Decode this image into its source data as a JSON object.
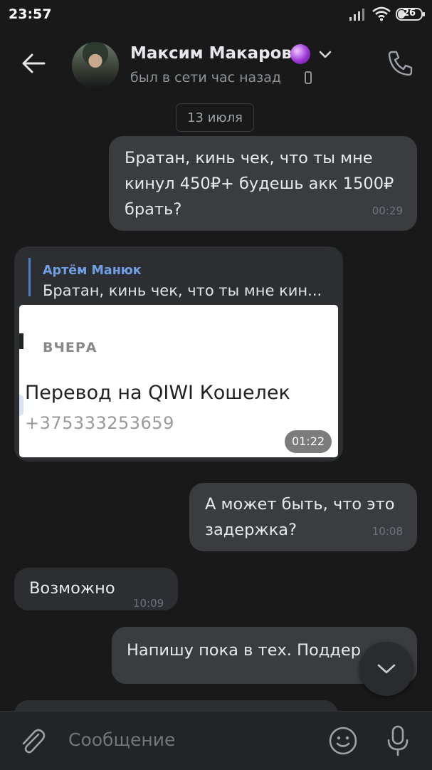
{
  "status_bar": {
    "time": "23:57",
    "battery": "26"
  },
  "header": {
    "name": "Максим Макаров",
    "status": "был в сети час назад"
  },
  "date_separator": "13 июля",
  "messages": [
    {
      "dir": "out",
      "text": "Братан, кинь чек, что ты мне кинул 450₽+ будешь акк 1500₽ брать?",
      "time": "00:29"
    },
    {
      "dir": "in",
      "reply": {
        "author": "Артём Манюк",
        "text": "Братан, кинь чек, что ты мне кин..."
      },
      "image": {
        "day_label": "ВЧЕРА",
        "title": "Перевод на QIWI Кошелек",
        "number": "+375333253659"
      },
      "time": "01:22"
    },
    {
      "dir": "out",
      "text": "А может быть, что это задержка?",
      "time": "10:08"
    },
    {
      "dir": "in",
      "text": "Возможно",
      "time": "10:09"
    },
    {
      "dir": "out",
      "text": "Напишу пока в тех. Поддер"
    }
  ],
  "composer": {
    "placeholder": "Сообщение"
  },
  "icons": {
    "back": "arrow-left-icon",
    "call": "phone-icon",
    "attach": "paperclip-icon",
    "emoji": "smiley-icon",
    "mic": "microphone-icon",
    "scroll": "chevron-down-icon"
  },
  "colors": {
    "accent": "#6fa0e6",
    "background": "#19191a",
    "outgoing_bubble": "#3b3c3f",
    "incoming_bubble": "#2d2e31"
  }
}
